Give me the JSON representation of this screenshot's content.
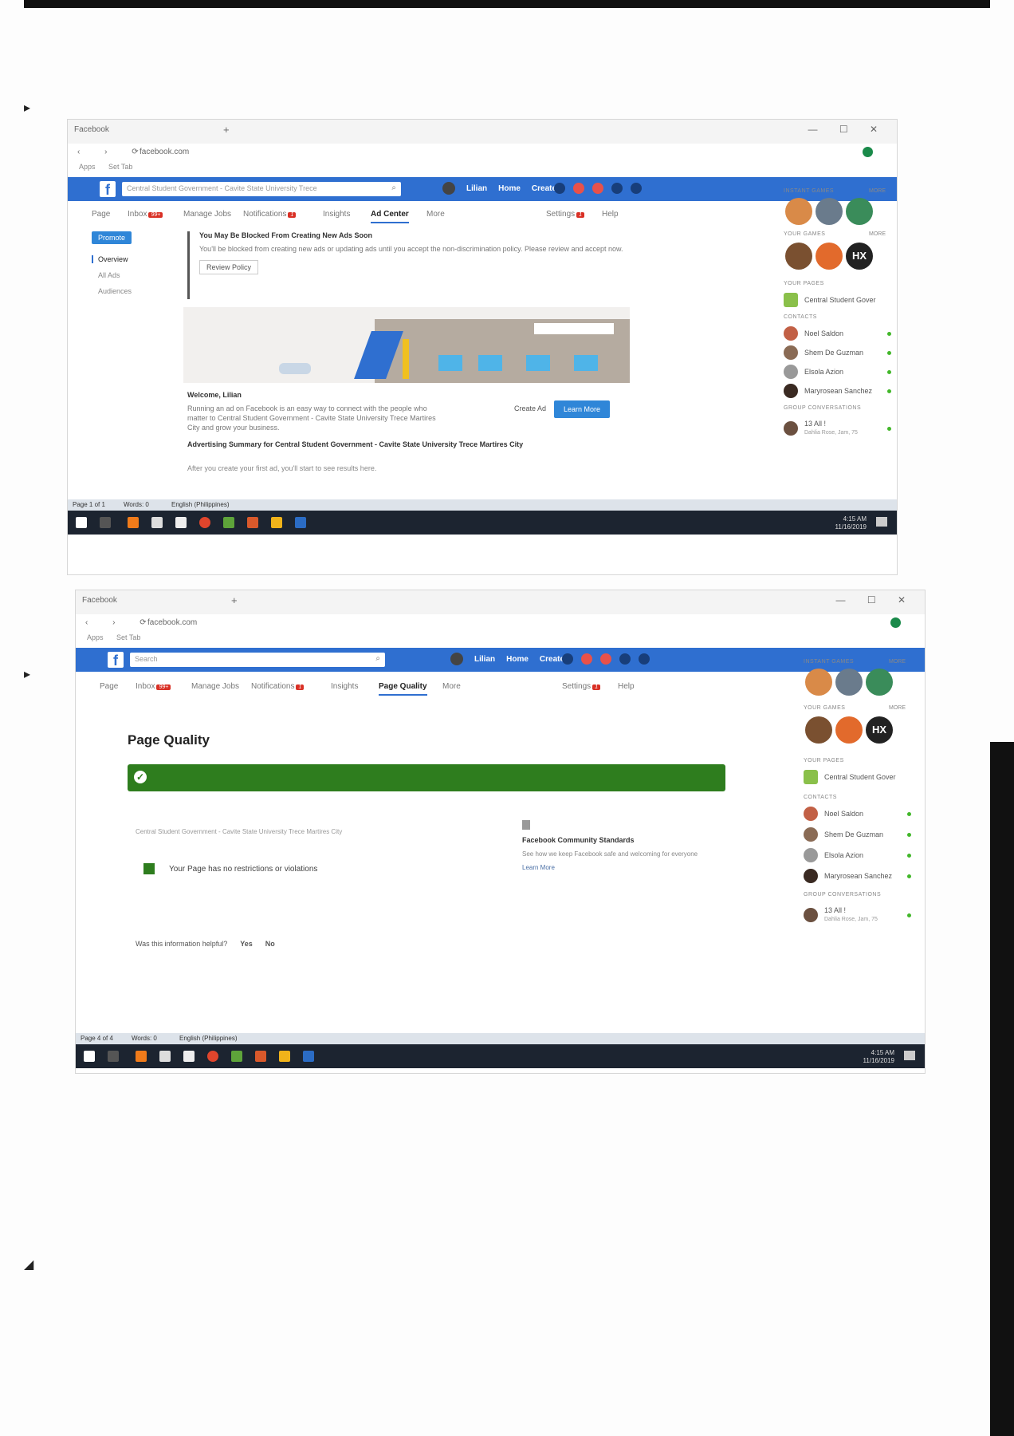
{
  "shot1": {
    "browser_tab": "Facebook",
    "window_controls": "— ☐ ✕",
    "url": "facebook.com",
    "bookmarks": [
      "Apps",
      "Set Tab"
    ],
    "search_text": "Central Student Government - Cavite State University Trece",
    "user_name": "Lilian",
    "nav_home": "Home",
    "nav_create": "Create",
    "tabs": {
      "page": "Page",
      "inbox": "Inbox",
      "inbox_badge": "99+",
      "manage_jobs": "Manage Jobs",
      "notifications": "Notifications",
      "notifications_badge": "1",
      "insights": "Insights",
      "ad_center": "Ad Center",
      "more": "More",
      "settings": "Settings",
      "settings_badge": "1",
      "help": "Help"
    },
    "left_menu": {
      "promote": "Promote",
      "overview": "Overview",
      "all_ads": "All Ads",
      "audiences": "Audiences"
    },
    "notice_title": "You May Be Blocked From Creating New Ads Soon",
    "notice_body": "You'll be blocked from creating new ads or updating ads until you accept the non-discrimination policy. Please review and accept now.",
    "review_policy": "Review Policy",
    "welcome_title": "Welcome, Lilian",
    "welcome_body": "Running an ad on Facebook is an easy way to connect with the people who matter to Central Student Government - Cavite State University Trece Martires City and grow your business.",
    "create_ad": "Create Ad",
    "learn_more": "Learn More",
    "summary": "Advertising Summary for Central Student Government - Cavite State University Trece Martires City",
    "summary_note": "After you create your first ad, you'll start to see results here.",
    "statusbar": {
      "page": "Page 1 of 1",
      "words": "Words: 0",
      "lang": "English (Philippines)"
    },
    "clock": {
      "time": "4:15 AM",
      "date": "11/16/2019"
    }
  },
  "shot2": {
    "browser_tab": "Facebook",
    "window_controls": "— ☐ ✕",
    "url": "facebook.com",
    "bookmarks": [
      "Apps",
      "Set Tab"
    ],
    "search_text": "Search",
    "user_name": "Lilian",
    "nav_home": "Home",
    "nav_create": "Create",
    "tabs": {
      "page": "Page",
      "inbox": "Inbox",
      "inbox_badge": "99+",
      "manage_jobs": "Manage Jobs",
      "notifications": "Notifications",
      "notifications_badge": "1",
      "insights": "Insights",
      "page_quality": "Page Quality",
      "more": "More",
      "settings": "Settings",
      "settings_badge": "1",
      "help": "Help"
    },
    "title": "Page Quality",
    "page_name": "Central Student Government - Cavite State University Trece Martires City",
    "no_restrictions": "Your Page has no restrictions or violations",
    "standards_title": "Facebook Community Standards",
    "standards_body": "See how we keep Facebook safe and welcoming for everyone",
    "learn_more": "Learn More",
    "helpful_question": "Was this information helpful?",
    "yes": "Yes",
    "no": "No",
    "statusbar": {
      "page": "Page 4 of 4",
      "words": "Words: 0",
      "lang": "English (Philippines)"
    },
    "clock": {
      "time": "4:15 AM",
      "date": "11/16/2019"
    }
  },
  "sidebar": {
    "instant_games": "INSTANT GAMES",
    "your_games": "YOUR GAMES",
    "more": "MORE",
    "hx": "HX",
    "your_pages": "YOUR PAGES",
    "page_item": "Central Student Gover",
    "contacts": "CONTACTS",
    "contact_list": [
      "Noel Saldon",
      "Shem De Guzman",
      "Elsola Azion",
      "Maryrosean Sanchez"
    ],
    "group_conversations": "GROUP CONVERSATIONS",
    "group": {
      "name": "13 All !",
      "members": "Dahlia Rose, Jam, 75"
    }
  },
  "colors": {
    "facebook_blue": "#2f6fd0",
    "quality_green": "#2e7d1e",
    "taskbar": "#1c2430"
  }
}
